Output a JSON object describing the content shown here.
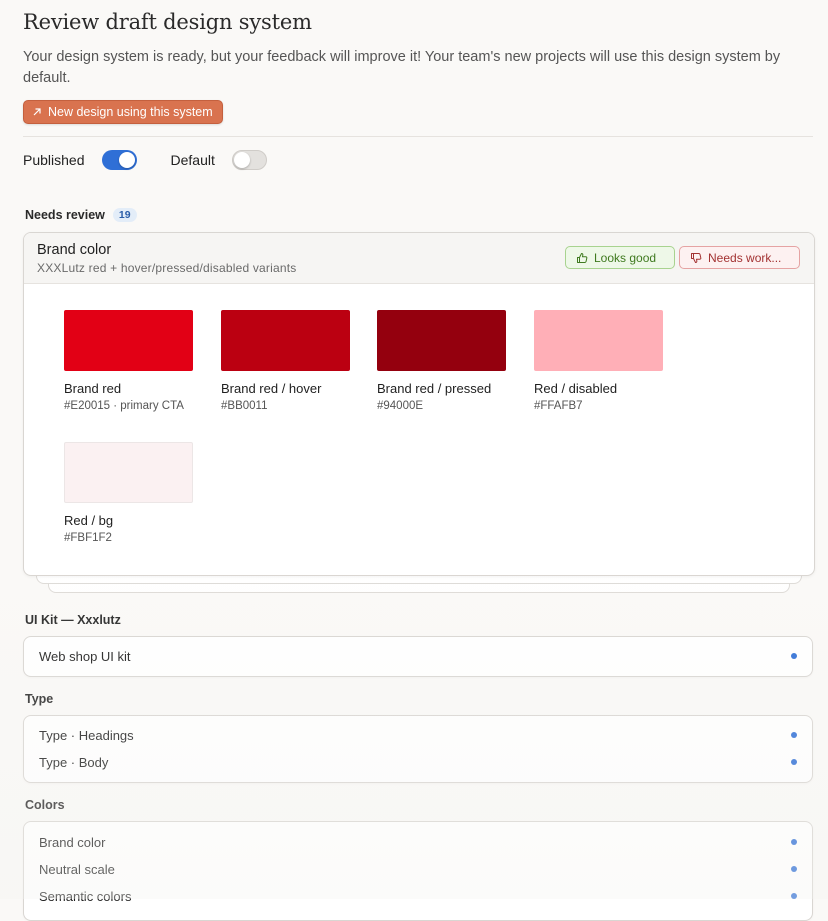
{
  "header": {
    "title": "Review draft design system",
    "subtitle": "Your design system is ready, but your feedback will improve it! Your team's new projects will use this design system by default.",
    "cta_label": "New design using this system"
  },
  "toggles": {
    "published_label": "Published",
    "published_on": true,
    "default_label": "Default",
    "default_on": false
  },
  "needs_review": {
    "label": "Needs review",
    "count": "19",
    "card": {
      "title": "Brand color",
      "subtitle": "XXXLutz red + hover/pressed/disabled variants",
      "looks_good_label": "Looks good",
      "needs_work_label": "Needs work...",
      "swatches": [
        {
          "name": "Brand red",
          "hex_label": "#E20015 · primary CTA",
          "color": "#E20015"
        },
        {
          "name": "Brand red / hover",
          "hex_label": "#BB0011",
          "color": "#BB0011"
        },
        {
          "name": "Brand red / pressed",
          "hex_label": "#94000E",
          "color": "#94000E"
        },
        {
          "name": "Red / disabled",
          "hex_label": "#FFAFB7",
          "color": "#FFAFB7"
        },
        {
          "name": "Red / bg",
          "hex_label": "#FBF1F2",
          "color": "#FBF1F2"
        }
      ]
    }
  },
  "sections": [
    {
      "label": "UI Kit — Xxxlutz",
      "items": [
        "Web shop UI kit"
      ]
    },
    {
      "label": "Type",
      "items": [
        "Type · Headings",
        "Type · Body"
      ]
    },
    {
      "label": "Colors",
      "items": [
        "Brand color",
        "Neutral scale",
        "Semantic colors"
      ]
    }
  ],
  "colors": {
    "accent": "#2F6FD6",
    "cta": "#D9734F"
  }
}
